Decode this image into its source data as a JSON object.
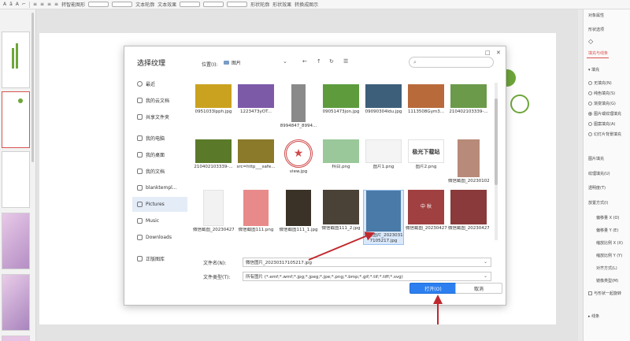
{
  "ribbon": {
    "items": [
      "A",
      "ǎ",
      "A",
      "⌐",
      "≡",
      "≡",
      "≡",
      "≡",
      "转智能图形",
      "文本轮廓",
      "文本效果",
      "形状轮廓",
      "形状效果",
      "转换成图示"
    ]
  },
  "right_panel": {
    "title": "对象属性",
    "tab": "形状选项",
    "subtab": "填充与线条",
    "section_fill": "填充",
    "fill_options": [
      "无填充(N)",
      "纯色填充(S)",
      "渐变填充(G)",
      "图片或纹理填充",
      "图案填充(A)",
      "幻灯片背景填充"
    ],
    "fill_selected_index": 3,
    "props": [
      "图片填充",
      "纹理填充(U)",
      "透明度(T)",
      "放置方式(I)",
      "偏移量 X (O)",
      "偏移量 Y (E)",
      "缩放比例 X (X)",
      "缩放比例 Y (Y)",
      "对齐方式(L)",
      "镜像类型(M)"
    ],
    "rotate_with_shape": "与形状一起旋转",
    "section_line": "线条"
  },
  "dialog": {
    "title": "选择纹理",
    "location_label": "位置(I):",
    "location_value": "图片",
    "nav": {
      "back": "←",
      "dropdown": "⌄",
      "up": "↑",
      "refresh": "↻",
      "view": "☰"
    },
    "search_icon": "⌕",
    "window_buttons": [
      "□",
      "✕"
    ],
    "sidebar": [
      {
        "label": "最近",
        "icon": "clock-icon"
      },
      {
        "label": "我的云文档",
        "icon": "cloud-icon"
      },
      {
        "label": "共享文件夹",
        "icon": "share-icon"
      },
      {
        "label": "我的电脑",
        "icon": "computer-icon"
      },
      {
        "label": "我的桌面",
        "icon": "desktop-icon"
      },
      {
        "label": "我的文档",
        "icon": "document-icon"
      },
      {
        "label": "blanktempl...",
        "icon": "folder-icon"
      },
      {
        "label": "Pictures",
        "icon": "folder-icon"
      },
      {
        "label": "Music",
        "icon": "music-icon"
      },
      {
        "label": "Downloads",
        "icon": "download-icon"
      },
      {
        "label": "正版图库",
        "icon": "gallery-icon"
      }
    ],
    "sidebar_selected_index": 7,
    "files": [
      {
        "name": "0951033lpph.jpg",
        "color": "#caa21f"
      },
      {
        "name": "1223473yOT...",
        "color": "#7c5aa8"
      },
      {
        "name": "8994847_8994...",
        "color": "#8a8a8a"
      },
      {
        "name": "09051473jon.jpg",
        "color": "#5d9b3d"
      },
      {
        "name": "09090304ldu.jpg",
        "color": "#3d5f7a"
      },
      {
        "name": "1113508Gym3...",
        "color": "#b86a3a"
      },
      {
        "name": "210402103339-...",
        "color": "#6a9a4a"
      },
      {
        "name": "210402103339-...",
        "color": "#5a7a2a"
      },
      {
        "name": "src=http___safe...",
        "color": "#8a7a2a"
      },
      {
        "name": "view.jpg",
        "color": "#d04a4a"
      },
      {
        "name": "科目.png",
        "color": "#9ac89a"
      },
      {
        "name": "图片1.png",
        "color": "#f4f4f4"
      },
      {
        "name": "图片2.png",
        "color": "#ffffff"
      },
      {
        "name": "微信截图_20230102154...",
        "color": "#b88a7a"
      },
      {
        "name": "微信截图_20230427104...",
        "color": "#f2f2f2"
      },
      {
        "name": "微信截图111.png",
        "color": "#e88a8a"
      },
      {
        "name": "微信截图111_1.jpg",
        "color": "#3a3226"
      },
      {
        "name": "微信截图111_2.jpg",
        "color": "#4a4236"
      },
      {
        "name": "微信图片_20230317105217.jpg",
        "color": "#4a7aa8"
      },
      {
        "name": "微信截图_20230427125...",
        "color": "#a04040"
      },
      {
        "name": "微信截图_20230427125...",
        "color": "#8a3a3a"
      }
    ],
    "thumb_texts": {
      "watermark": "极光下载站",
      "poster_title": "中 秋"
    },
    "selected_file_index": 18,
    "filename_label": "文件名(N):",
    "filename_value": "微信图片_20230317105217.jpg",
    "filetype_label": "文件类型(T):",
    "filetype_value": "所有图片 (*.emf;*.wmf;*.jpg;*.jpeg;*.jpe;*.png;*.bmp;*.gif;*.tif;*.tiff;*.svg)",
    "open_button": "打开(O)",
    "cancel_button": "取消"
  },
  "colors": {
    "accent": "#d9534f",
    "primary_button": "#2d7ff0",
    "deco_green": "#6ea63a",
    "arrow": "#c0282d"
  }
}
